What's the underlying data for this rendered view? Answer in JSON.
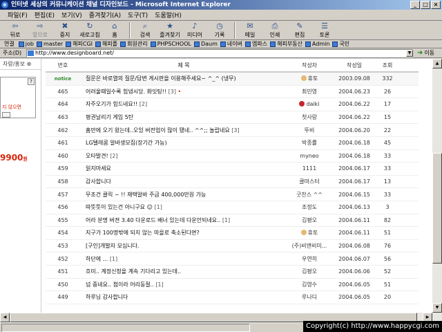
{
  "window": {
    "title": "인터넷 세상의 커뮤니케이션 채널 디자인보드 - Microsoft Internet Explorer",
    "controls": [
      "_",
      "□",
      "×"
    ]
  },
  "menu": [
    "파일(F)",
    "편집(E)",
    "보기(V)",
    "즐겨찾기(A)",
    "도구(T)",
    "도움말(H)"
  ],
  "toolbar": [
    {
      "label": "뒤로",
      "icon": "back-arrow-icon",
      "glyph": "⇦",
      "enabled": true
    },
    {
      "label": "앞으로",
      "icon": "forward-arrow-icon",
      "glyph": "⇨",
      "enabled": false
    },
    {
      "label": "중지",
      "icon": "stop-icon",
      "glyph": "✖",
      "enabled": true
    },
    {
      "label": "새로고침",
      "icon": "refresh-icon",
      "glyph": "↻",
      "enabled": true
    },
    {
      "label": "홈",
      "icon": "home-icon",
      "glyph": "⌂",
      "enabled": true
    },
    {
      "label": "검색",
      "icon": "search-icon",
      "glyph": "⌕",
      "enabled": true
    },
    {
      "label": "즐겨찾기",
      "icon": "favorites-icon",
      "glyph": "★",
      "enabled": true
    },
    {
      "label": "미디어",
      "icon": "media-icon",
      "glyph": "♪",
      "enabled": true
    },
    {
      "label": "기록",
      "icon": "history-icon",
      "glyph": "◷",
      "enabled": true
    },
    {
      "label": "메일",
      "icon": "mail-icon",
      "glyph": "✉",
      "enabled": true
    },
    {
      "label": "인쇄",
      "icon": "print-icon",
      "glyph": "⎙",
      "enabled": true
    },
    {
      "label": "편집",
      "icon": "edit-icon",
      "glyph": "✎",
      "enabled": true
    },
    {
      "label": "토론",
      "icon": "discuss-icon",
      "glyph": "☰",
      "enabled": true
    }
  ],
  "links": {
    "label": "연결",
    "items": [
      "job",
      "master",
      "해피CGI",
      "해피플",
      "회원관리",
      "PHPSCHOOL",
      "Daum",
      "네이버",
      "엠파스",
      "해피부동산",
      "Admin",
      "국민"
    ]
  },
  "address": {
    "label": "주소(D)",
    "url": "http://www.designboard.net/",
    "go_label": "이동"
  },
  "left_panel": {
    "header": "자랑/홍보",
    "help": "?",
    "promo_text": "지 않으면",
    "price": "9900",
    "price_unit": "원"
  },
  "board": {
    "headers": {
      "num": "번호",
      "subject": "제 목",
      "author": "작성자",
      "date": "작성일",
      "views": "조회"
    },
    "rows": [
      {
        "num": "notice",
        "subject": "질문은 바로열의 질문/답변 게시판을 이용해주세요~ ^_^ (냉무)",
        "author": "휴토",
        "date": "2003.09.08",
        "views": "332",
        "notice": true,
        "avatar": "face"
      },
      {
        "num": "465",
        "subject": "어려울때일수록 힘냅시당. 화잇팅!!",
        "comments": "[3]",
        "new": "•",
        "author": "최민영",
        "date": "2004.06.23",
        "views": "26"
      },
      {
        "num": "464",
        "subject": "자주오기가 힘드네요!!",
        "comments": "[2]",
        "author": "daiki",
        "date": "2004.06.22",
        "views": "17",
        "avatar": "berry"
      },
      {
        "num": "463",
        "subject": "평권날리기 게임 5탄",
        "author": "첫사랑",
        "date": "2004.06.22",
        "views": "15"
      },
      {
        "num": "462",
        "subject": "홈만에 오기 왔는데..오잉 버전업이 많이 됐네.. ^^;; 놀랍네요",
        "comments": "[3]",
        "author": "뚜비",
        "date": "2004.06.20",
        "views": "22"
      },
      {
        "num": "461",
        "subject": "LG텔레콤 알바생모집(장기간 가능)",
        "author": "박종률",
        "date": "2004.06.18",
        "views": "45"
      },
      {
        "num": "460",
        "subject": "오타발견!",
        "comments": "[2]",
        "author": "myneo",
        "date": "2004.06.18",
        "views": "33"
      },
      {
        "num": "459",
        "subject": "읽지마세요",
        "author": "1111",
        "date": "2004.06.17",
        "views": "33"
      },
      {
        "num": "458",
        "subject": "감사합니다",
        "author": "클마스터",
        "date": "2004.06.17",
        "views": "13"
      },
      {
        "num": "457",
        "subject": "무조건 클릭 ~ !! 재택알바 주급 400,000만원 가능",
        "author": "굿찬스 ^^",
        "date": "2004.06.15",
        "views": "33"
      },
      {
        "num": "456",
        "subject": "따뜻뜻이 있는건 아니구요",
        "comments": "[1]",
        "emote": "☺",
        "author": "조정도",
        "date": "2004.06.13",
        "views": "3"
      },
      {
        "num": "455",
        "subject": "어라 분명 버젼 3.40 다운로드 배너 있는데 다운안되네요..",
        "comments": "[1]",
        "author": "김평오",
        "date": "2004.06.11",
        "views": "82"
      },
      {
        "num": "454",
        "subject": "지구가 100명밖에 되지 않는 마을로 축소된다면?",
        "author": "휴토",
        "date": "2004.06.11",
        "views": "51",
        "avatar": "face"
      },
      {
        "num": "453",
        "subject": "[구인]개발자 모십니다.",
        "author": "(주)비앤비미...",
        "date": "2004.06.08",
        "views": "76"
      },
      {
        "num": "452",
        "subject": "하단에 ...",
        "comments": "[1]",
        "author": "우연히",
        "date": "2004.06.07",
        "views": "56"
      },
      {
        "num": "451",
        "subject": "흐미.. 계정신청을 계속 기다리고 있는데..",
        "author": "김평오",
        "date": "2004.06.06",
        "views": "52"
      },
      {
        "num": "450",
        "subject": "넘 중네요.. 첨이라 어리둥절..",
        "comments": "[1]",
        "author": "김영수",
        "date": "2004.06.05",
        "views": "51"
      },
      {
        "num": "449",
        "subject": "하루님 감사합니다",
        "author": "루나디",
        "date": "2004.06.05",
        "views": "20"
      }
    ]
  },
  "overlay": {
    "copyright": "Copyright(c) http://www.happycgi.com"
  }
}
